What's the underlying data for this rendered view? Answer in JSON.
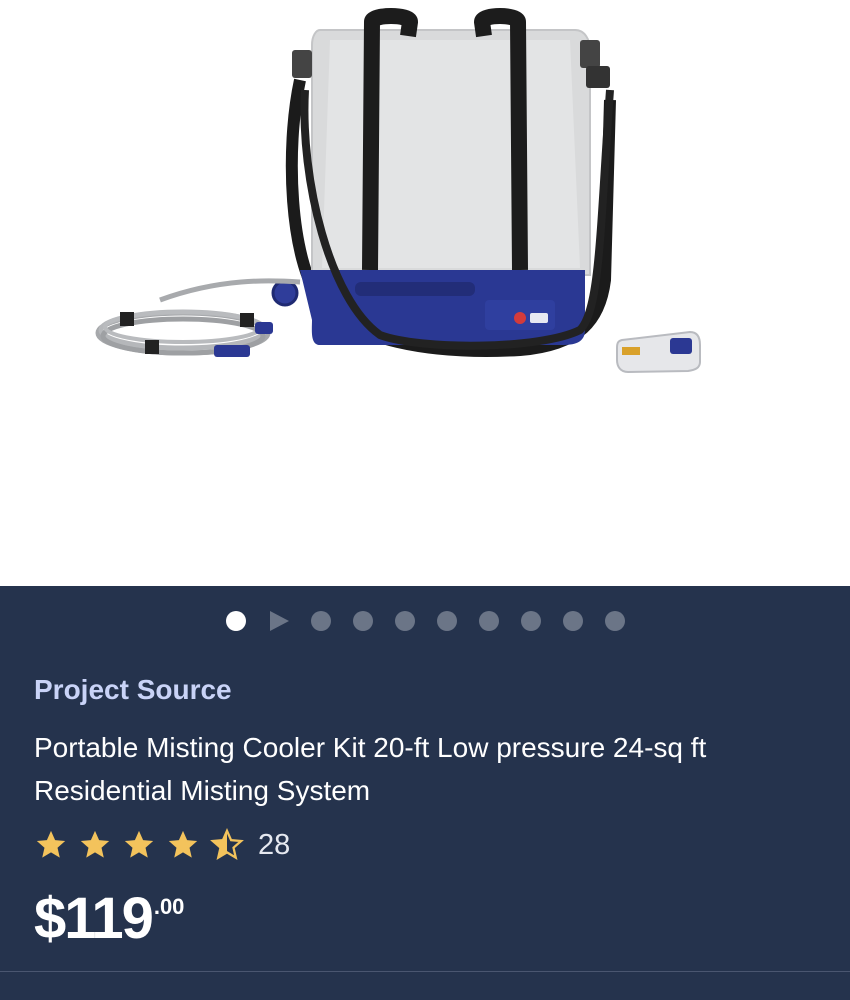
{
  "product": {
    "image_alt": "Portable misting cooler bag with hose and battery",
    "brand": "Project Source",
    "title": "Portable Misting Cooler Kit 20-ft Low pressure 24-sq ft Residential Misting System",
    "rating": 4.5,
    "review_count": "28",
    "price_dollars": "$119",
    "price_cents": ".00"
  },
  "carousel": {
    "total_slides": 10,
    "active_index": 0,
    "has_video_slide": true
  },
  "colors": {
    "panel_bg": "#25334d",
    "brand_text": "#c9d3f7",
    "star_fill": "#f3c35c",
    "dot_inactive": "#6b7587",
    "dot_active": "#ffffff"
  }
}
